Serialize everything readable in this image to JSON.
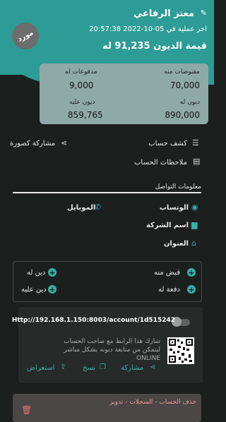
{
  "header": {
    "name": "معتز الرفاعي",
    "last_operation": "اخر عملية في 05-10-2022 20:57:38",
    "debt_value": "قيمة الديون 91,235 له",
    "badge": "مورد"
  },
  "stats": {
    "received_label": "مقبوضات منه",
    "received_value": "70,000",
    "payments_label": "مدفوعات له",
    "payments_value": "9,000",
    "debts_for_label": "ديون له",
    "debts_for_value": "890,000",
    "debts_on_label": "ديون عليه",
    "debts_on_value": "859,765"
  },
  "menu": {
    "statement": "كشف حساب",
    "share_broken": "مشاركة كصورة",
    "notes": "ملاحظات الحساب"
  },
  "contact": {
    "section_title": "معلومات التواصل",
    "whatsapp": "الوتساب",
    "mobile": "الموبايل",
    "company": "اسم الشركة",
    "address": "العنوان"
  },
  "actions": {
    "receive": "قبض منه",
    "debt_for": "دين له",
    "pay": "دفعة له",
    "debt_on": "دين عليه"
  },
  "link": {
    "url": "Http://192.168.1.150:8003/account/1d515242",
    "description": "شارك هذا الرابط مع صاحب الحساب ليتمكن من متابعة ديونه بشكل مباشر ONLINE",
    "share": "مشاركة",
    "copy": "نسخ",
    "preview": "استعراض"
  },
  "bottom": {
    "title": "حذف الحساب - السجلات - تدوير"
  }
}
